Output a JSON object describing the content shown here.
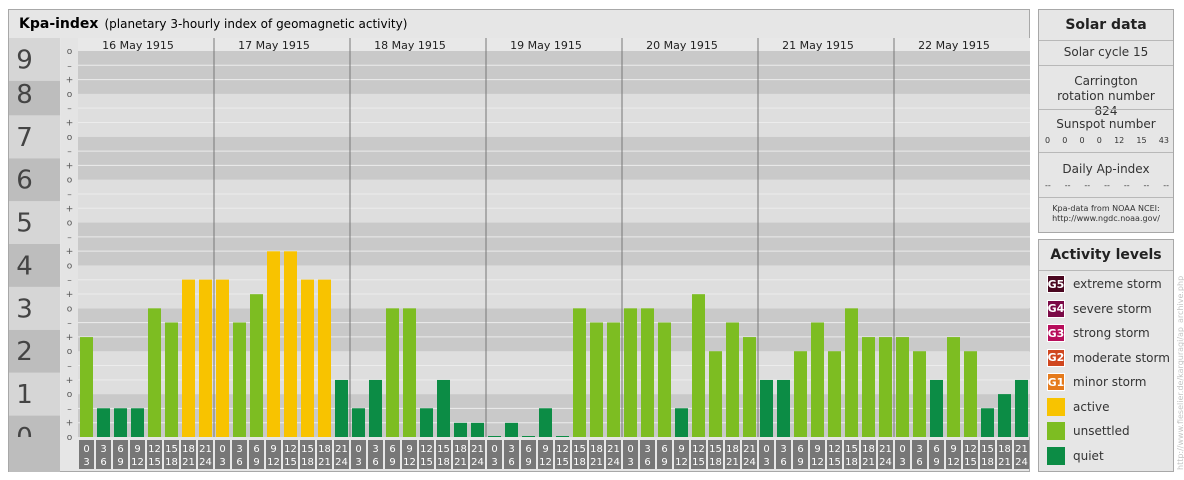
{
  "header": {
    "title": "Kpa-index",
    "subtitle": "(planetary 3-hourly index of geomagnetic activity)"
  },
  "chart_data": {
    "type": "bar",
    "title": "Kpa-index",
    "subtitle": "(planetary 3-hourly index of geomagnetic activity)",
    "ylim": [
      0,
      9
    ],
    "y_ticks": [
      "0",
      "1",
      "2",
      "3",
      "4",
      "5",
      "6",
      "7",
      "8",
      "9"
    ],
    "minor_tick_marks": [
      "o",
      "+",
      "–"
    ],
    "days": [
      "16 May 1915",
      "17 May 1915",
      "18 May 1915",
      "19 May 1915",
      "20 May 1915",
      "21 May 1915",
      "22 May 1915"
    ],
    "interval_start_hours": [
      "0",
      "3",
      "6",
      "9",
      "12",
      "15",
      "18",
      "21"
    ],
    "interval_end_hours": [
      "3",
      "6",
      "9",
      "12",
      "15",
      "18",
      "21",
      "24"
    ],
    "values": [
      [
        2.33,
        0.67,
        0.67,
        0.67,
        3.0,
        2.67,
        3.67,
        3.67
      ],
      [
        3.67,
        2.67,
        3.33,
        4.33,
        4.33,
        3.67,
        3.67,
        1.33
      ],
      [
        0.67,
        1.33,
        3.0,
        3.0,
        0.67,
        1.33,
        0.33,
        0.33
      ],
      [
        0.0,
        0.33,
        0.0,
        0.67,
        0.0,
        3.0,
        2.67,
        2.67
      ],
      [
        3.0,
        3.0,
        2.67,
        0.67,
        3.33,
        2.0,
        2.67,
        2.33
      ],
      [
        1.33,
        1.33,
        2.0,
        2.67,
        2.0,
        3.0,
        2.33,
        2.33
      ],
      [
        2.33,
        2.0,
        1.33,
        2.33,
        2.0,
        0.67,
        1.0,
        1.33
      ]
    ],
    "colors": {
      "quiet": "#0c8c45",
      "unsettled": "#7dbd22",
      "active": "#f8c300",
      "minor_storm": "#e57a1c",
      "moderate_storm": "#d0461e",
      "strong_storm": "#b70e5b",
      "severe_storm": "#7b0a47",
      "extreme_storm": "#4a0720"
    }
  },
  "solar": {
    "title": "Solar data",
    "cycle": "Solar cycle 15",
    "carrington": "Carrington rotation number 824",
    "sunspot_label": "Sunspot number",
    "sunspot_values": [
      "0",
      "0",
      "0",
      "0",
      "12",
      "15",
      "43"
    ],
    "ap_label": "Daily Ap-index",
    "ap_values": [
      "--",
      "--",
      "--",
      "--",
      "--",
      "--",
      "--"
    ],
    "credit_line1": "Kpa-data from NOAA NCEI:",
    "credit_line2": "http://www.ngdc.noaa.gov/"
  },
  "levels": {
    "title": "Activity levels",
    "items": [
      {
        "code": "G5",
        "label": "extreme storm",
        "color": "#4a0720"
      },
      {
        "code": "G4",
        "label": "severe storm",
        "color": "#7b0a47"
      },
      {
        "code": "G3",
        "label": "strong storm",
        "color": "#b70e5b"
      },
      {
        "code": "G2",
        "label": "moderate storm",
        "color": "#d0461e"
      },
      {
        "code": "G1",
        "label": "minor storm",
        "color": "#e57a1c"
      },
      {
        "code": "",
        "label": "active",
        "color": "#f8c300"
      },
      {
        "code": "",
        "label": "unsettled",
        "color": "#7dbd22"
      },
      {
        "code": "",
        "label": "quiet",
        "color": "#0c8c45"
      }
    ]
  },
  "side_credit": "http://www.fieselier.de/karguragi/ap_archive.php"
}
